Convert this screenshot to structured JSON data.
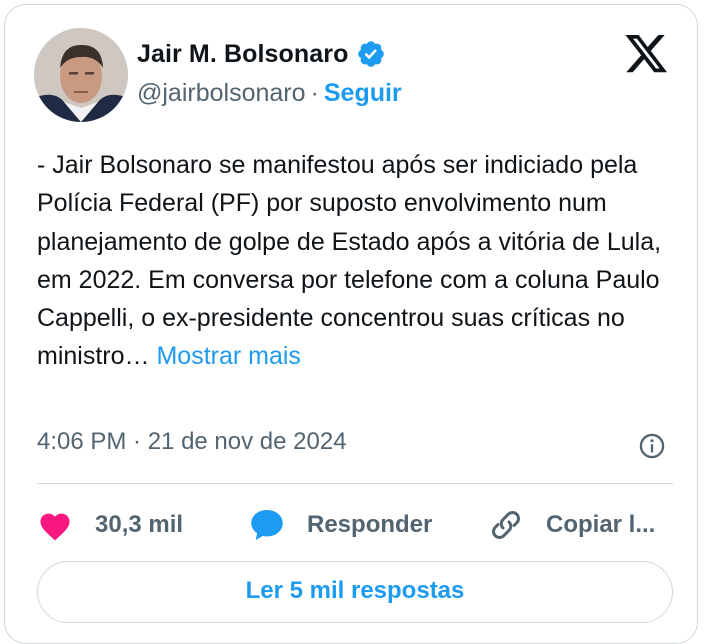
{
  "author": {
    "name": "Jair M. Bolsonaro",
    "handle": "@jairbolsonaro",
    "separator": "·",
    "follow_label": "Seguir"
  },
  "tweet": {
    "text": "- Jair Bolsonaro se manifestou após ser indiciado pela Polícia Federal (PF) por suposto envolvimento num planejamento de golpe de Estado após a vitória de Lula, em 2022. Em conversa por telefone com a coluna Paulo Cappelli, o ex-presidente concentrou suas críticas no ministro…",
    "show_more": "Mostrar mais",
    "timestamp": "4:06 PM · 21 de nov de 2024"
  },
  "actions": {
    "likes": "30,3 mil",
    "reply": "Responder",
    "copy": "Copiar l..."
  },
  "read_replies": "Ler 5 mil respostas",
  "colors": {
    "accent": "#1d9bf0",
    "like": "#f91880",
    "muted": "#536471",
    "border": "#cfd9de"
  },
  "icons": [
    "verified-badge-icon",
    "x-logo-icon",
    "info-icon",
    "heart-icon",
    "reply-bubble-icon",
    "link-icon"
  ]
}
